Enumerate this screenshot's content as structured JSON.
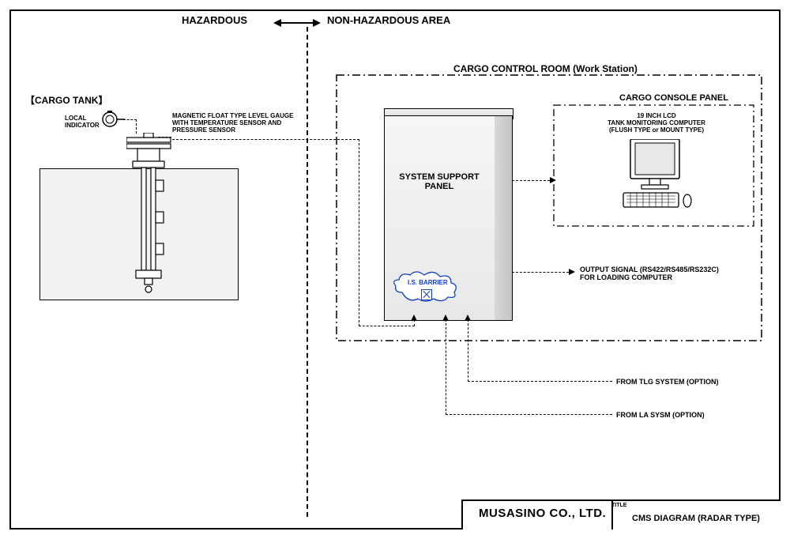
{
  "header": {
    "hazardous": "HAZARDOUS",
    "nonhazardous": "NON-HAZARDOUS AREA"
  },
  "left": {
    "cargo_tank_label": "【CARGO TANK】",
    "local_indicator": "LOCAL\nINDICATOR",
    "gauge_label": "MAGNETIC FLOAT TYPE LEVEL GAUGE\nWITH TEMPERATURE SENSOR AND\nPRESSURE SENSOR"
  },
  "control_room": {
    "title": "CARGO CONTROL ROOM (Work Station)",
    "console_panel_title": "CARGO CONSOLE PANEL",
    "monitor_label": "19 INCH LCD\nTANK MONITORING COMPUTER\n(FLUSH TYPE or MOUNT TYPE)",
    "ssp_label": "SYSTEM SUPPORT\nPANEL",
    "is_barrier": "I.S. BARRIER",
    "output_signal": "OUTPUT SIGNAL (RS422/RS485/RS232C)\nFOR LOADING COMPUTER",
    "from_tlg": "FROM TLG SYSTEM (OPTION)",
    "from_la": "FROM LA SYSM (OPTION)"
  },
  "titleblock": {
    "company": "MUSASINO CO., LTD.",
    "title_word": "TITLE",
    "title_value": "CMS DIAGRAM (RADAR TYPE)"
  }
}
